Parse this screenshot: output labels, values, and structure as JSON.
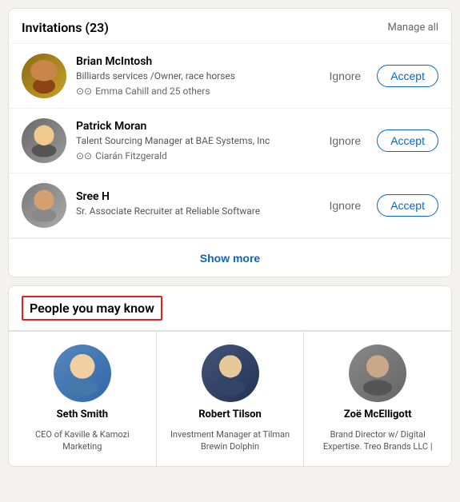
{
  "invitations": {
    "title": "Invitations",
    "count": "(23)",
    "manage_all": "Manage all",
    "show_more": "Show more",
    "items": [
      {
        "id": "brian",
        "name": "Brian McIntosh",
        "job_title": "Billiards services /Owner, race horses",
        "mutual": "Emma Cahill and 25 others",
        "ignore_label": "Ignore",
        "accept_label": "Accept"
      },
      {
        "id": "patrick",
        "name": "Patrick Moran",
        "job_title": "Talent Sourcing Manager at BAE Systems, Inc",
        "mutual": "Ciarán Fitzgerald",
        "ignore_label": "Ignore",
        "accept_label": "Accept"
      },
      {
        "id": "sree",
        "name": "Sree H",
        "job_title": "Sr. Associate Recruiter at Reliable Software",
        "mutual": "",
        "ignore_label": "Ignore",
        "accept_label": "Accept"
      }
    ]
  },
  "pymk": {
    "title": "People you may know",
    "people": [
      {
        "id": "seth",
        "name": "Seth Smith",
        "role": "CEO of Kaville & Kamozi Marketing"
      },
      {
        "id": "robert",
        "name": "Robert Tilson",
        "role": "Investment Manager at Tilman Brewin Dolphin"
      },
      {
        "id": "zoe",
        "name": "Zoë McElligott",
        "role": "Brand Director w/ Digital Expertise. Treo Brands LLC |"
      }
    ]
  }
}
